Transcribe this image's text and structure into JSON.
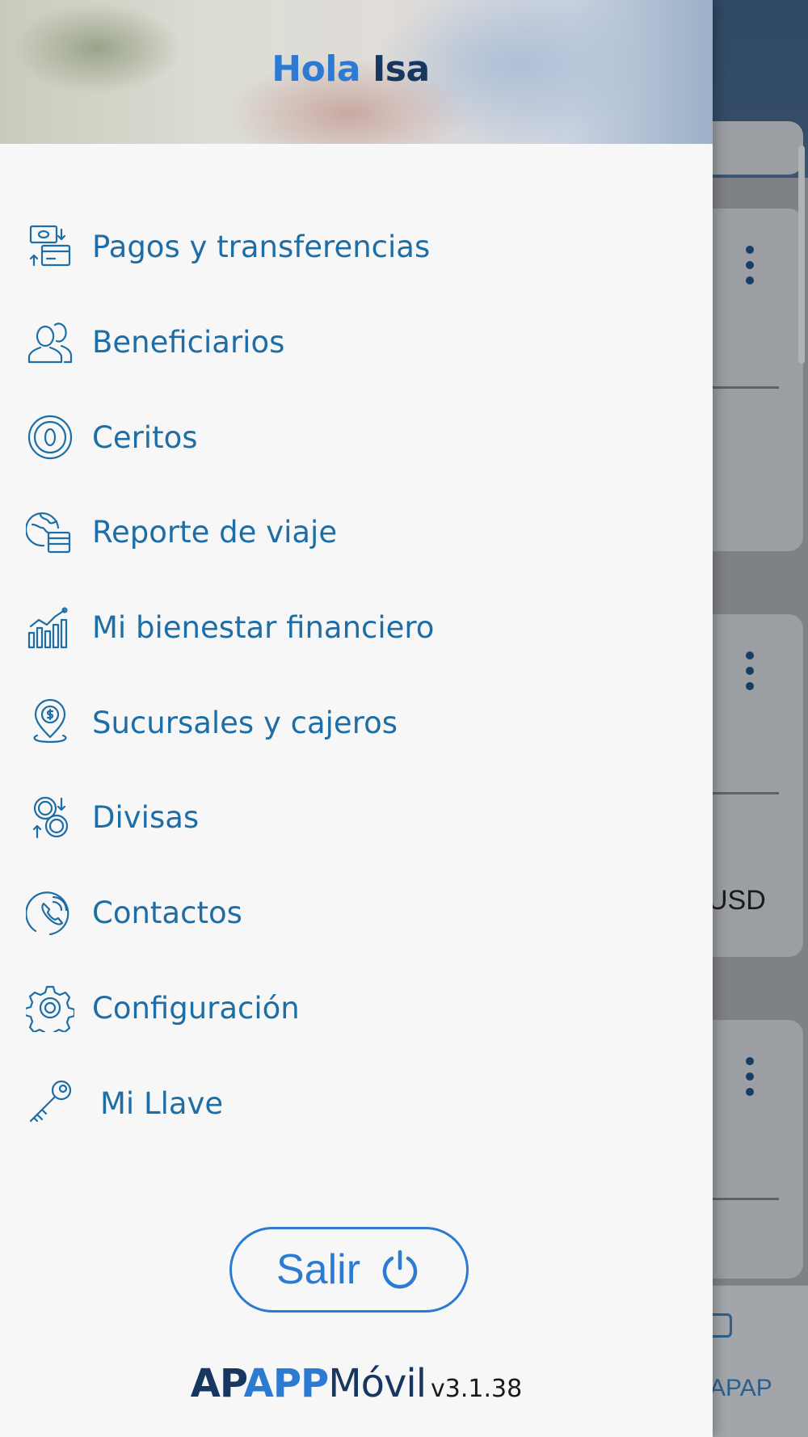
{
  "header": {
    "greeting": "Hola",
    "user_name": "Isa"
  },
  "menu": {
    "items": [
      {
        "label": "Pagos y transferencias",
        "icon": "payments-transfer-icon"
      },
      {
        "label": "Beneficiarios",
        "icon": "beneficiaries-icon"
      },
      {
        "label": "Ceritos",
        "icon": "ceritos-coin-icon"
      },
      {
        "label": "Reporte de viaje",
        "icon": "travel-report-icon"
      },
      {
        "label": "Mi bienestar financiero",
        "icon": "financial-wellbeing-chart-icon"
      },
      {
        "label": "Sucursales y cajeros",
        "icon": "branch-location-icon"
      },
      {
        "label": "Divisas",
        "icon": "currency-exchange-icon"
      },
      {
        "label": "Contactos",
        "icon": "contact-phone-icon"
      },
      {
        "label": "Configuración",
        "icon": "settings-gear-icon"
      },
      {
        "label": "Mi Llave",
        "icon": "key-icon"
      }
    ]
  },
  "logout": {
    "label": "Salir",
    "icon": "power-icon"
  },
  "footer": {
    "brand_ap": "AP",
    "brand_app": "APP",
    "brand_movil": "Móvil",
    "version": "v3.1.38"
  },
  "background": {
    "currency_text": "USD",
    "nav_label": "APAP"
  },
  "colors": {
    "primary": "#2c7bd3",
    "dark_navy": "#173660",
    "menu_text": "#1d6ea6",
    "drawer_bg": "#f7f7f7"
  }
}
